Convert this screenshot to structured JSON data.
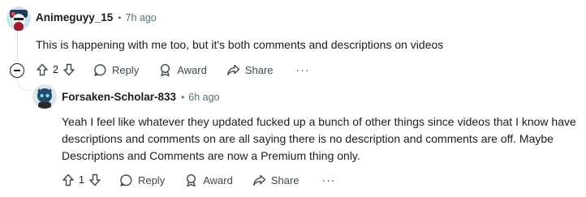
{
  "comments": [
    {
      "username": "Animeguyy_15",
      "separator": "•",
      "time": "7h ago",
      "text": "This is happening with me too, but it's both comments and descriptions on videos",
      "votes": "2",
      "reply_label": "Reply",
      "award_label": "Award",
      "share_label": "Share",
      "more_label": "···"
    },
    {
      "username": "Forsaken-Scholar-833",
      "separator": "•",
      "time": "6h ago",
      "text_lines": [
        "Yeah I feel like whatever they updated fucked up a bunch of other things since videos that I know have",
        "descriptions and comments on are all saying there is no description and comments are off. Maybe",
        "Descriptions and Comments are now a Premium thing only."
      ],
      "votes": "1",
      "reply_label": "Reply",
      "award_label": "Award",
      "share_label": "Share",
      "more_label": "···"
    }
  ],
  "icons": {
    "upvote": "upvote-icon",
    "downvote": "downvote-icon",
    "reply": "comment-bubble-icon",
    "award": "award-icon",
    "share": "share-arrow-icon",
    "collapse": "collapse-minus-icon"
  },
  "colors": {
    "text": "#1c1c1c",
    "meta": "#576f76",
    "thread": "#dfe3e6"
  }
}
